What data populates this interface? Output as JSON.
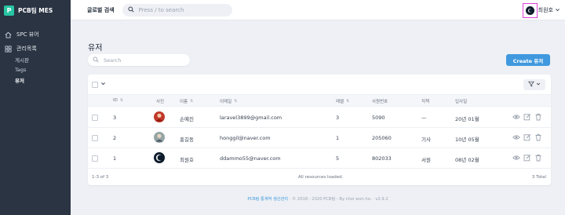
{
  "app": {
    "name": "PCB팀 MES",
    "logo_letter": "P"
  },
  "sidebar": {
    "spc_label": "SPC 뷰어",
    "admin_label": "관리목록",
    "sub_items": [
      {
        "label": "게시판"
      },
      {
        "label": "Tags"
      },
      {
        "label": "유저"
      }
    ]
  },
  "header": {
    "global_search_label": "글로벌 검색",
    "search_placeholder": "Press / to search",
    "user_name": "최원호"
  },
  "page": {
    "title": "유저",
    "search_placeholder": "Search",
    "create_label": "Create 유저"
  },
  "table": {
    "columns": [
      "ID",
      "사진",
      "이름",
      "이메일",
      "레벨",
      "사원번호",
      "직책",
      "입사일"
    ],
    "rows": [
      {
        "id": "3",
        "name": "손예진",
        "email": "laravel3899@gmail.com",
        "level": "3",
        "emp_no": "5090",
        "position": "—",
        "hired": "20년 01월",
        "photo_color": "#c0392b"
      },
      {
        "id": "2",
        "name": "홍길동",
        "email": "honggil@naver.com",
        "level": "1",
        "emp_no": "205060",
        "position": "기사",
        "hired": "10년 05월",
        "photo_color": "#7f8c8d"
      },
      {
        "id": "1",
        "name": "최원호",
        "email": "ddammo55@naver.com",
        "level": "5",
        "emp_no": "802033",
        "position": "서원",
        "hired": "08년 02월",
        "photo_color": "#0d1b2a"
      }
    ],
    "footer_range": "1-3 of 3",
    "footer_status": "All resources loaded.",
    "footer_total": "3 Total"
  },
  "copyright": {
    "link_text": "PCB팀 통계적 생산관리",
    "rest": "· © 2018 - 2020 PCB팀 - By choi won ho. · v2.9.2"
  },
  "colors": {
    "accent": "#4099de",
    "sidebar": "#2a3443",
    "brand": "#28c4a4",
    "highlight": "#e040d8"
  }
}
